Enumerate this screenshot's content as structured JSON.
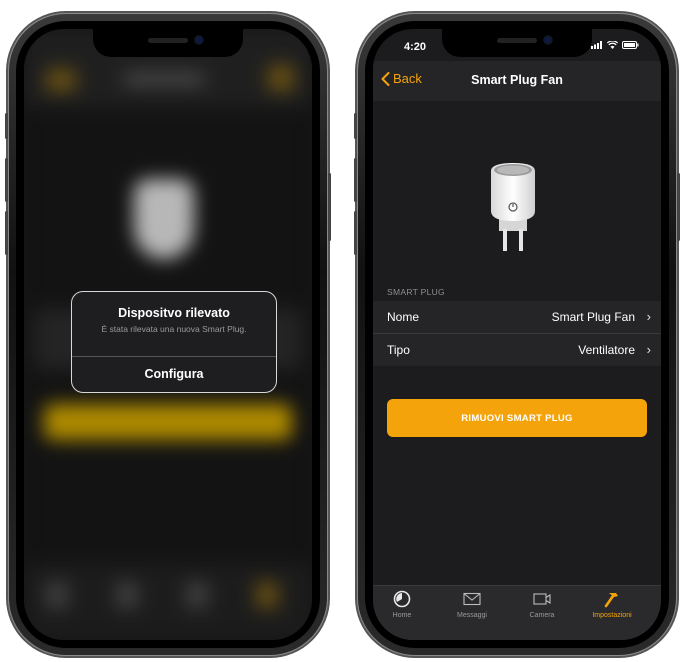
{
  "left_screen": {
    "alert": {
      "title": "Dispositvo rilevato",
      "message": "È stata rilevata una nuova Smart Plug.",
      "action": "Configura"
    }
  },
  "right_screen": {
    "status_time": "4:20",
    "nav": {
      "back": "Back",
      "title": "Smart Plug Fan"
    },
    "section_label": "SMART PLUG",
    "rows": [
      {
        "label": "Nome",
        "value": "Smart Plug Fan"
      },
      {
        "label": "Tipo",
        "value": "Ventilatore"
      }
    ],
    "remove_button": "RIMUOVI SMART PLUG",
    "tabs": [
      {
        "label": "Home",
        "icon": "home-icon"
      },
      {
        "label": "Messaggi",
        "icon": "mail-icon"
      },
      {
        "label": "Camera",
        "icon": "video-camera-icon"
      },
      {
        "label": "Impostazioni",
        "icon": "hammer-icon"
      }
    ],
    "active_tab": "Impostazioni"
  },
  "colors": {
    "accent": "#f5a30a",
    "background": "#1c1c1e",
    "surface": "#252527"
  }
}
